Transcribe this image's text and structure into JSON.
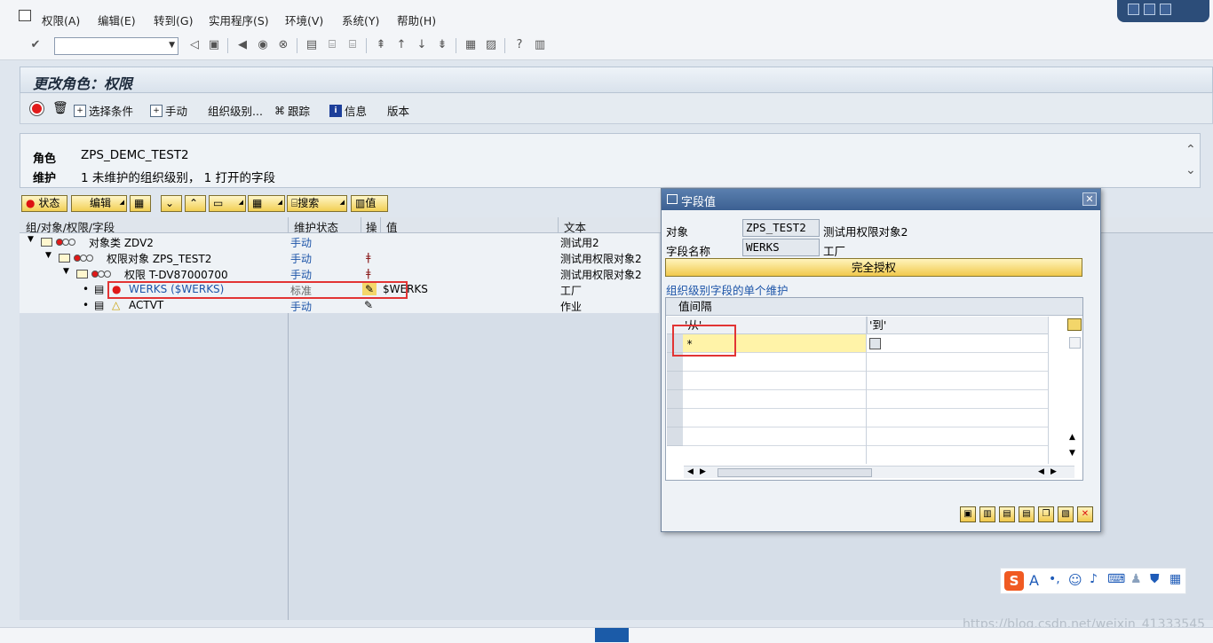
{
  "menu": {
    "items": [
      "权限(A)",
      "编辑(E)",
      "转到(G)",
      "实用程序(S)",
      "环境(V)",
      "系统(Y)",
      "帮助(H)"
    ]
  },
  "screen": {
    "title": "更改角色：权限"
  },
  "app_toolbar": {
    "select_criteria": "选择条件",
    "manual": "手动",
    "org_levels": "组织级别...",
    "trace": "跟踪",
    "info": "信息",
    "version": "版本"
  },
  "header": {
    "role_label": "角色",
    "role_value": "ZPS_DEMC_TEST2",
    "maint_label": "维护",
    "maint_value": "1 未维护的组织级别， 1 打开的字段"
  },
  "tree_toolbar": {
    "status": "状态",
    "edit": "编辑",
    "search": "搜索",
    "value": "值"
  },
  "tree_columns": {
    "group": "组/对象/权限/字段",
    "maint_status": "维护状态",
    "op": "操",
    "value": "值",
    "text": "文本"
  },
  "tree_rows": [
    {
      "node": "对象类 ZDV2",
      "maint_status": "手动",
      "value": "",
      "text": "测试用2"
    },
    {
      "node": "权限对象 ZPS_TEST2",
      "maint_status": "手动",
      "value": "",
      "text": "测试用权限对象2"
    },
    {
      "node": "权限 T-DV87000700",
      "maint_status": "手动",
      "value": "",
      "text": "测试用权限对象2"
    },
    {
      "node": "WERKS ($WERKS)",
      "maint_status": "标准",
      "value": "$WERKS",
      "text": "工厂"
    },
    {
      "node": "ACTVT",
      "maint_status": "手动",
      "value": "",
      "text": "作业"
    }
  ],
  "dialog": {
    "title": "字段值",
    "object_label": "对象",
    "object_value": "ZPS_TEST2",
    "object_desc": "测试用权限对象2",
    "field_label": "字段名称",
    "field_value": "WERKS",
    "field_desc": "工厂",
    "full_auth": "完全授权",
    "section_title": "组织级别字段的单个维护",
    "grid_title": "值间隔",
    "col_from": "'从'",
    "col_to": "'到'",
    "from_value": "*"
  },
  "watermark": "https://blog.csdn.net/weixin_41333545",
  "colors": {
    "title_blue": "#3c6092",
    "button_yellow": "#f2cf53",
    "highlight_red": "#e23434",
    "link_blue": "#1c54a8"
  }
}
